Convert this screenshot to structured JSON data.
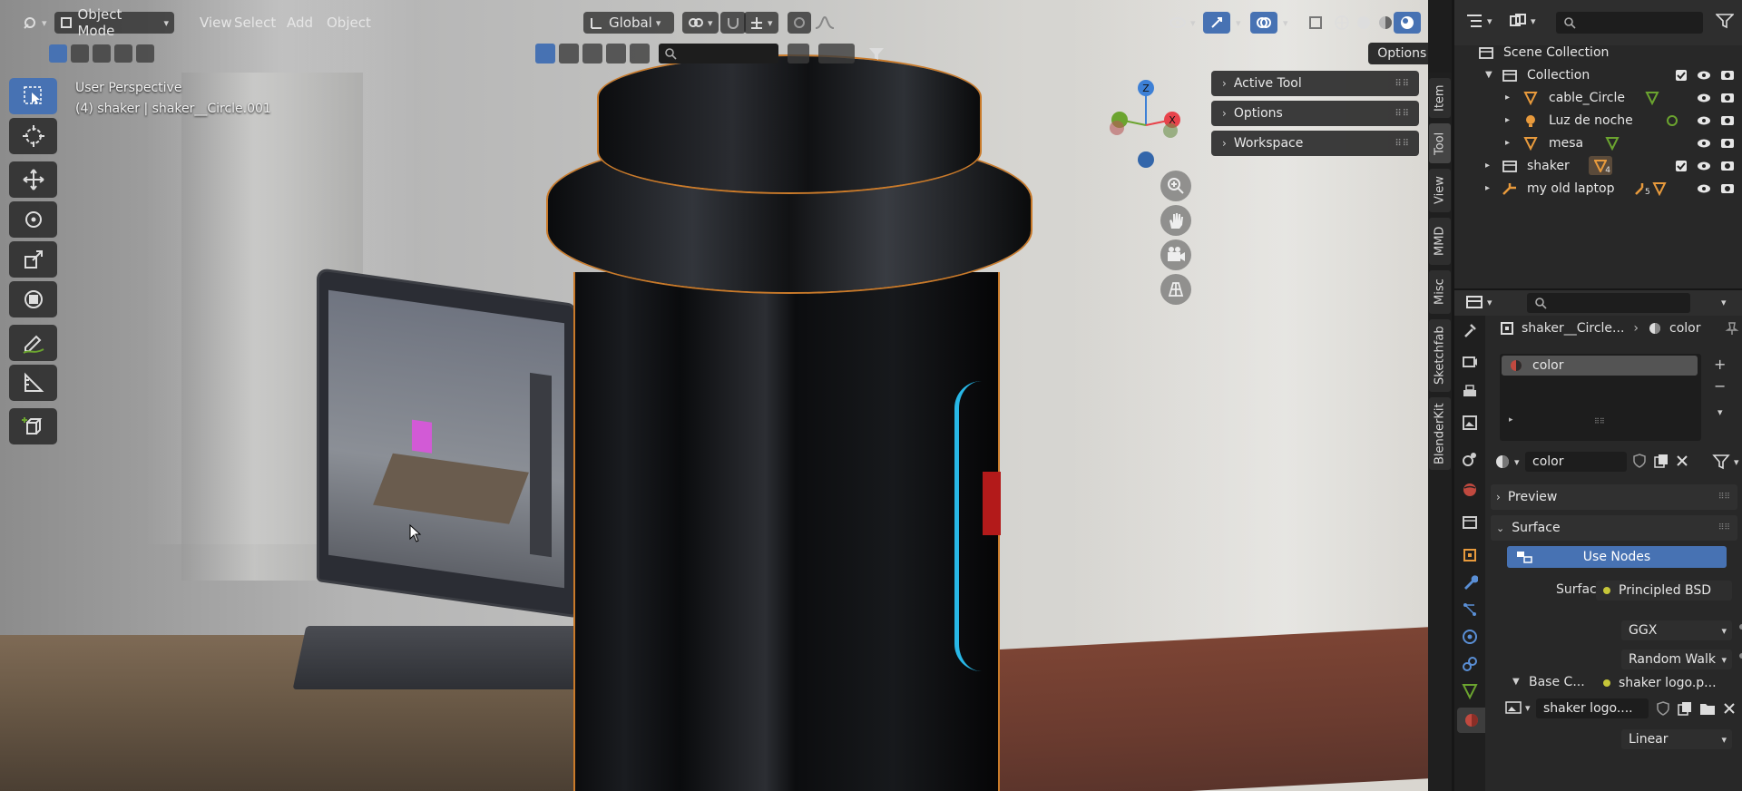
{
  "header": {
    "editor_type_icon": "editor-type-icon",
    "mode": "Object Mode",
    "menus": [
      "View",
      "Select",
      "Add",
      "Object"
    ],
    "transform_orientation": "Global",
    "options_label": "Options"
  },
  "viewport": {
    "perspective": "User Perspective",
    "object_info": "(4) shaker | shaker__Circle.001"
  },
  "npanel": {
    "panels": [
      "Active Tool",
      "Options",
      "Workspace"
    ],
    "tabs": [
      "Item",
      "Tool",
      "View",
      "MMD",
      "Misc",
      "Sketchfab",
      "BlenderKit"
    ],
    "active_tab": "Tool"
  },
  "outliner": {
    "root": "Scene Collection",
    "rows": [
      {
        "label": "Collection",
        "indent": 1
      },
      {
        "label": "cable_Circle",
        "indent": 2
      },
      {
        "label": "Luz de noche",
        "indent": 2
      },
      {
        "label": "mesa",
        "indent": 2
      },
      {
        "label": "shaker",
        "indent": 1,
        "badge": "4"
      },
      {
        "label": "my old laptop",
        "indent": 1,
        "badge": "5"
      }
    ]
  },
  "properties": {
    "breadcrumb_object": "shaker__Circle...",
    "breadcrumb_material": "color",
    "slot_name": "color",
    "material_name": "color",
    "section_preview": "Preview",
    "section_surface": "Surface",
    "use_nodes": "Use Nodes",
    "surface_label": "Surface",
    "surface_value": "Principled BSD",
    "distribution": "GGX",
    "subsurface": "Random Walk",
    "base_color_label": "Base C...",
    "base_color_value": "shaker logo.p...",
    "image_name": "shaker logo....",
    "interpolation": "Linear"
  },
  "colors": {
    "accent_blue": "#4772b3",
    "selection_orange": "#c97a2a",
    "axis_x": "#e8434b",
    "axis_y": "#6ba42f",
    "axis_z": "#3d80d6",
    "socket_yellow": "#c6c639"
  }
}
